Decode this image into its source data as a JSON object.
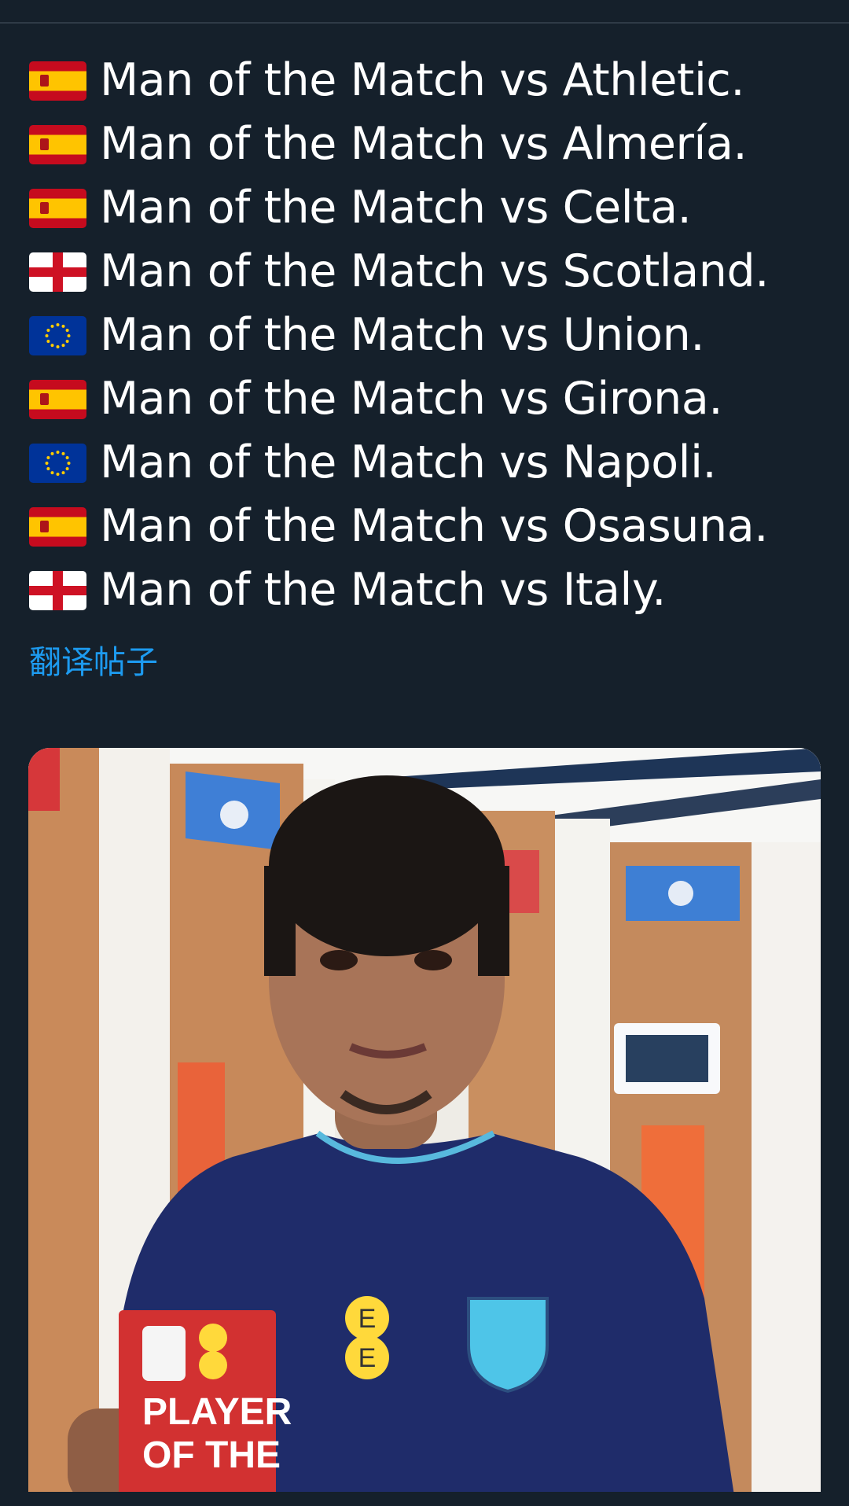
{
  "post": {
    "lines": [
      {
        "flag": "spain-flag",
        "text": "Man of the Match vs Athletic."
      },
      {
        "flag": "spain-flag",
        "text": "Man of the Match vs Almería."
      },
      {
        "flag": "spain-flag",
        "text": "Man of the Match vs Celta."
      },
      {
        "flag": "england-flag",
        "text": "Man of the Match vs Scotland."
      },
      {
        "flag": "eu-flag",
        "text": "Man of the Match vs Union."
      },
      {
        "flag": "spain-flag",
        "text": "Man of the Match vs Girona."
      },
      {
        "flag": "eu-flag",
        "text": "Man of the Match vs Napoli."
      },
      {
        "flag": "spain-flag",
        "text": "Man of the Match vs Osasuna."
      },
      {
        "flag": "england-flag",
        "text": "Man of the Match vs Italy."
      }
    ],
    "translate_label": "翻译帖子"
  },
  "media": {
    "award_text": [
      "PLAYER",
      "OF THE"
    ],
    "sponsor_letter": "E"
  },
  "colors": {
    "background": "#15202b",
    "text": "#ffffff",
    "link": "#1d9bf0"
  }
}
